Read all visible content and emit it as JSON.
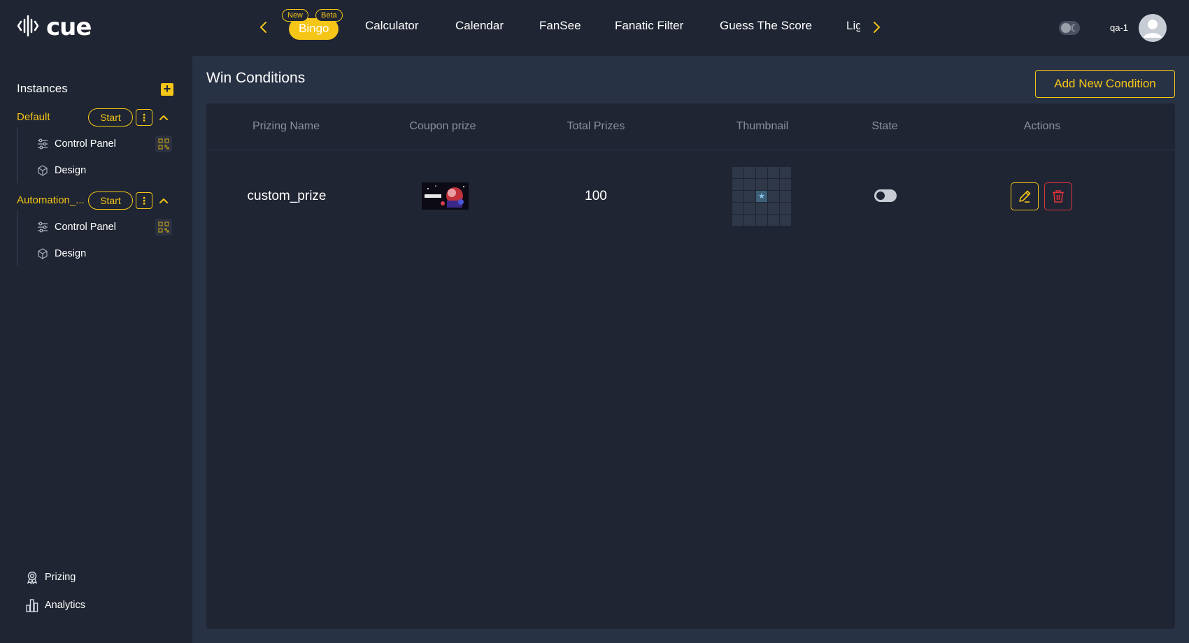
{
  "app": {
    "logo_text": "cue",
    "accent_color": "#f5c518",
    "danger_color": "#e0333b"
  },
  "topnav": {
    "prev_icon": "chevron-left-icon",
    "next_icon": "chevron-right-icon",
    "tabs": [
      {
        "label": "Bingo",
        "active": true
      },
      {
        "label": "Calculator"
      },
      {
        "label": "Calendar"
      },
      {
        "label": "FanSee"
      },
      {
        "label": "Fanatic Filter"
      },
      {
        "label": "Guess The Score"
      },
      {
        "label": "Lig"
      }
    ],
    "badges": {
      "new": "New",
      "beta": "Beta"
    },
    "theme_toggle_icon": "moon-icon",
    "username": "qa-1",
    "avatar_icon": "user-avatar-icon"
  },
  "sidebar": {
    "heading": "Instances",
    "add_icon": "plus-icon",
    "instances": [
      {
        "name": "Default",
        "start_label": "Start",
        "items": [
          {
            "label": "Control Panel",
            "icon": "sliders-icon"
          },
          {
            "label": "Design",
            "icon": "cube-icon"
          }
        ]
      },
      {
        "name": "Automation_...",
        "start_label": "Start",
        "items": [
          {
            "label": "Control Panel",
            "icon": "sliders-icon"
          },
          {
            "label": "Design",
            "icon": "cube-icon"
          }
        ]
      }
    ],
    "bottom_links": [
      {
        "label": "Prizing",
        "icon": "award-icon"
      },
      {
        "label": "Analytics",
        "icon": "bar-chart-icon"
      }
    ]
  },
  "main": {
    "title": "Win Conditions",
    "add_button_label": "Add New Condition",
    "columns": [
      "Prizing Name",
      "Coupon prize",
      "Total Prizes",
      "Thumbnail",
      "State",
      "Actions"
    ],
    "rows": [
      {
        "prizing_name": "custom_prize",
        "coupon_prize_image": "coupon-image",
        "total_prizes": "100",
        "thumbnail": "bingo-grid-thumbnail",
        "state_on": false,
        "edit_icon": "pencil-icon",
        "delete_icon": "trash-icon"
      }
    ]
  }
}
